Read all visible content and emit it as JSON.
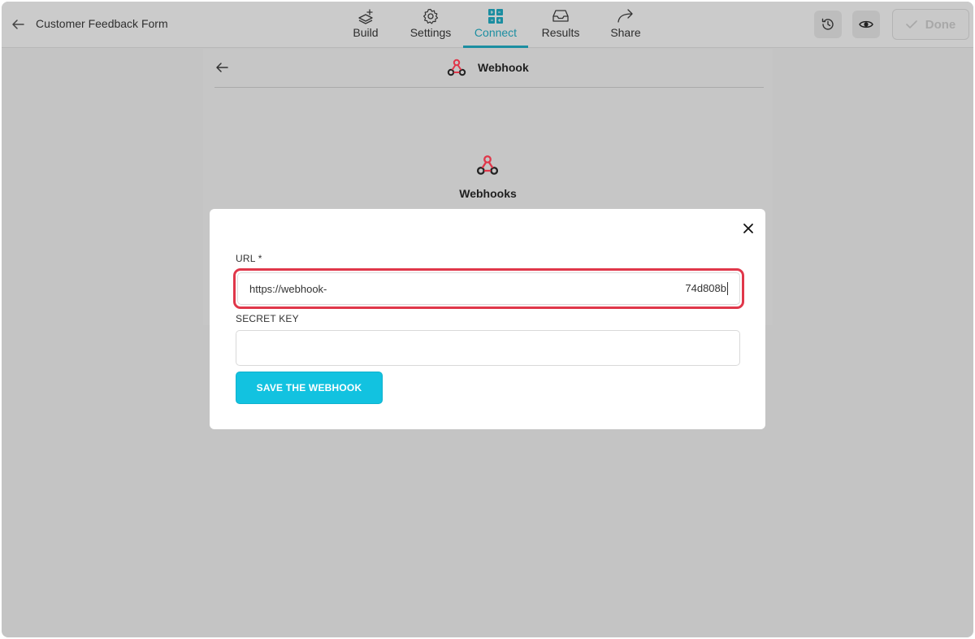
{
  "app": {
    "form_title": "Customer Feedback Form",
    "accent_color": "#1b8ea1",
    "webhook_icon_colors": [
      "#e0374a",
      "#1f1f1f"
    ]
  },
  "nav": {
    "items": [
      {
        "label": "Build",
        "icon": "build-icon",
        "active": false
      },
      {
        "label": "Settings",
        "icon": "gear-icon",
        "active": false
      },
      {
        "label": "Connect",
        "icon": "puzzle-icon",
        "active": true
      },
      {
        "label": "Results",
        "icon": "inbox-icon",
        "active": false
      },
      {
        "label": "Share",
        "icon": "share-arrow-icon",
        "active": false
      }
    ]
  },
  "toolbar": {
    "history_icon": "history-icon",
    "preview_icon": "eye-icon",
    "done_label": "Done"
  },
  "panel": {
    "title": "Webhook",
    "center_title": "Webhooks"
  },
  "modal": {
    "url_label": "URL *",
    "url_value_start": "https://webhook-",
    "url_value_end": "74d808b",
    "secret_label": "SECRET KEY",
    "secret_value": "",
    "save_label": "SAVE THE WEBHOOK",
    "highlight_color": "#e0374a",
    "button_color": "#12c2e0"
  }
}
